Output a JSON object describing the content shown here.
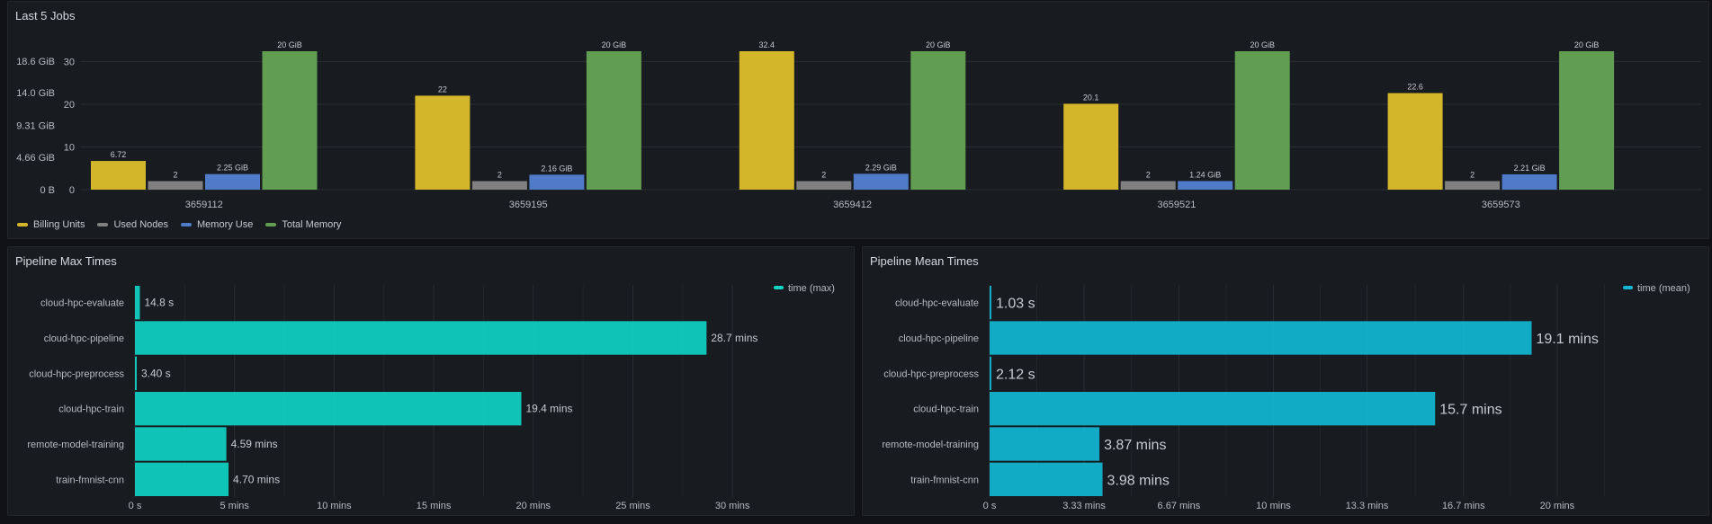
{
  "chart_data": [
    {
      "type": "bar",
      "title": "Last 5 Jobs",
      "categories": [
        "3659112",
        "3659195",
        "3659412",
        "3659521",
        "3659573"
      ],
      "series": [
        {
          "name": "Billing Units",
          "axis": "left-numeric",
          "color": "#d4b62a",
          "values": [
            6.72,
            22,
            32.4,
            20.1,
            22.6
          ],
          "labels": [
            "6.72",
            "22",
            "32.4",
            "20.1",
            "22.6"
          ]
        },
        {
          "name": "Used Nodes",
          "axis": "left-numeric",
          "color": "#808080",
          "values": [
            2,
            2,
            2,
            2,
            2
          ],
          "labels": [
            "2",
            "2",
            "2",
            "2",
            "2"
          ]
        },
        {
          "name": "Memory Use",
          "axis": "left-bytes",
          "color": "#4f7bc8",
          "values": [
            2.25,
            2.16,
            2.29,
            1.24,
            2.21
          ],
          "labels": [
            "2.25 GiB",
            "2.16 GiB",
            "2.29 GiB",
            "1.24 GiB",
            "2.21 GiB"
          ]
        },
        {
          "name": "Total Memory",
          "axis": "left-bytes",
          "color": "#629e51",
          "values": [
            20,
            20,
            20,
            20,
            20
          ],
          "labels": [
            "20 GiB",
            "20 GiB",
            "20 GiB",
            "20 GiB",
            "20 GiB"
          ]
        }
      ],
      "y_numeric": {
        "ylim": [
          0,
          32.4
        ],
        "ticks": [
          "0",
          "10",
          "20",
          "30"
        ],
        "tick_values": [
          0,
          10,
          20,
          30
        ]
      },
      "y_bytes": {
        "ylim": [
          0,
          20
        ],
        "ticks": [
          "0 B",
          "4.66 GiB",
          "9.31 GiB",
          "14.0 GiB",
          "18.6 GiB"
        ],
        "tick_values": [
          0,
          4.66,
          9.31,
          14.0,
          18.6
        ]
      },
      "grid": true,
      "legend_placement": "bottom-left"
    },
    {
      "type": "bar",
      "orientation": "horizontal",
      "title": "Pipeline Max Times",
      "categories": [
        "cloud-hpc-evaluate",
        "cloud-hpc-pipeline",
        "cloud-hpc-preprocess",
        "cloud-hpc-train",
        "remote-model-training",
        "train-fmnist-cnn"
      ],
      "series": [
        {
          "name": "time (max)",
          "color": "#0fd3c3",
          "unit": "mins",
          "values": [
            0.247,
            28.7,
            0.057,
            19.4,
            4.59,
            4.7
          ],
          "labels": [
            "14.8 s",
            "28.7 mins",
            "3.40 s",
            "19.4 mins",
            "4.59 mins",
            "4.70 mins"
          ]
        }
      ],
      "xlim": [
        0,
        31.8
      ],
      "xticks": [
        "0 s",
        "5 mins",
        "10 mins",
        "15 mins",
        "20 mins",
        "25 mins",
        "30 mins"
      ],
      "xtick_values": [
        0,
        5,
        10,
        15,
        20,
        25,
        30
      ],
      "grid": true,
      "legend_placement": "top-right"
    },
    {
      "type": "bar",
      "orientation": "horizontal",
      "title": "Pipeline Mean Times",
      "categories": [
        "cloud-hpc-evaluate",
        "cloud-hpc-pipeline",
        "cloud-hpc-preprocess",
        "cloud-hpc-train",
        "remote-model-training",
        "train-fmnist-cnn"
      ],
      "series": [
        {
          "name": "time (mean)",
          "color": "#12b7d4",
          "unit": "mins",
          "values": [
            0.0172,
            19.1,
            0.0353,
            15.7,
            3.87,
            3.98
          ],
          "labels": [
            "1.03 s",
            "19.1 mins",
            "2.12 s",
            "15.7 mins",
            "3.87 mins",
            "3.98 mins"
          ]
        }
      ],
      "xlim": [
        0,
        23.3
      ],
      "xticks": [
        "0 s",
        "3.33 mins",
        "6.67 mins",
        "10 mins",
        "13.3 mins",
        "16.7 mins",
        "20 mins"
      ],
      "xtick_values": [
        0,
        3.33,
        6.67,
        10,
        13.3,
        16.7,
        20
      ],
      "grid": true,
      "legend_placement": "top-right"
    }
  ]
}
